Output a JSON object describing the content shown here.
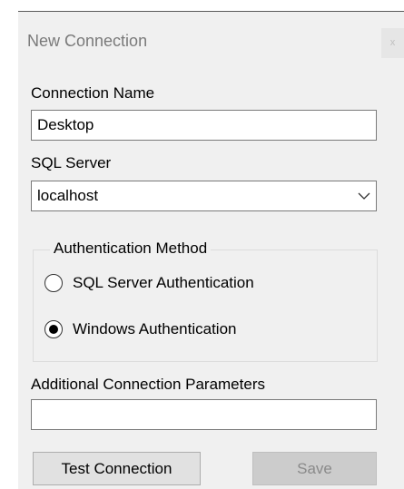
{
  "window": {
    "title": "New Connection",
    "close_glyph": "x"
  },
  "fields": {
    "connection_name_label": "Connection Name",
    "connection_name_value": "Desktop",
    "sql_server_label": "SQL Server",
    "sql_server_value": "localhost",
    "additional_params_label": "Additional Connection Parameters",
    "additional_params_value": ""
  },
  "auth": {
    "legend": "Authentication Method",
    "options": [
      {
        "label": "SQL Server Authentication",
        "selected": false
      },
      {
        "label": "Windows Authentication",
        "selected": true
      }
    ]
  },
  "buttons": {
    "test_label": "Test Connection",
    "save_label": "Save",
    "save_enabled": false
  },
  "icons": {
    "dropdown": "chevron-down-icon"
  },
  "colors": {
    "dialog_bg": "#f0f0f0",
    "border": "#7a7a7a",
    "disabled_text": "#8a8a8a"
  }
}
